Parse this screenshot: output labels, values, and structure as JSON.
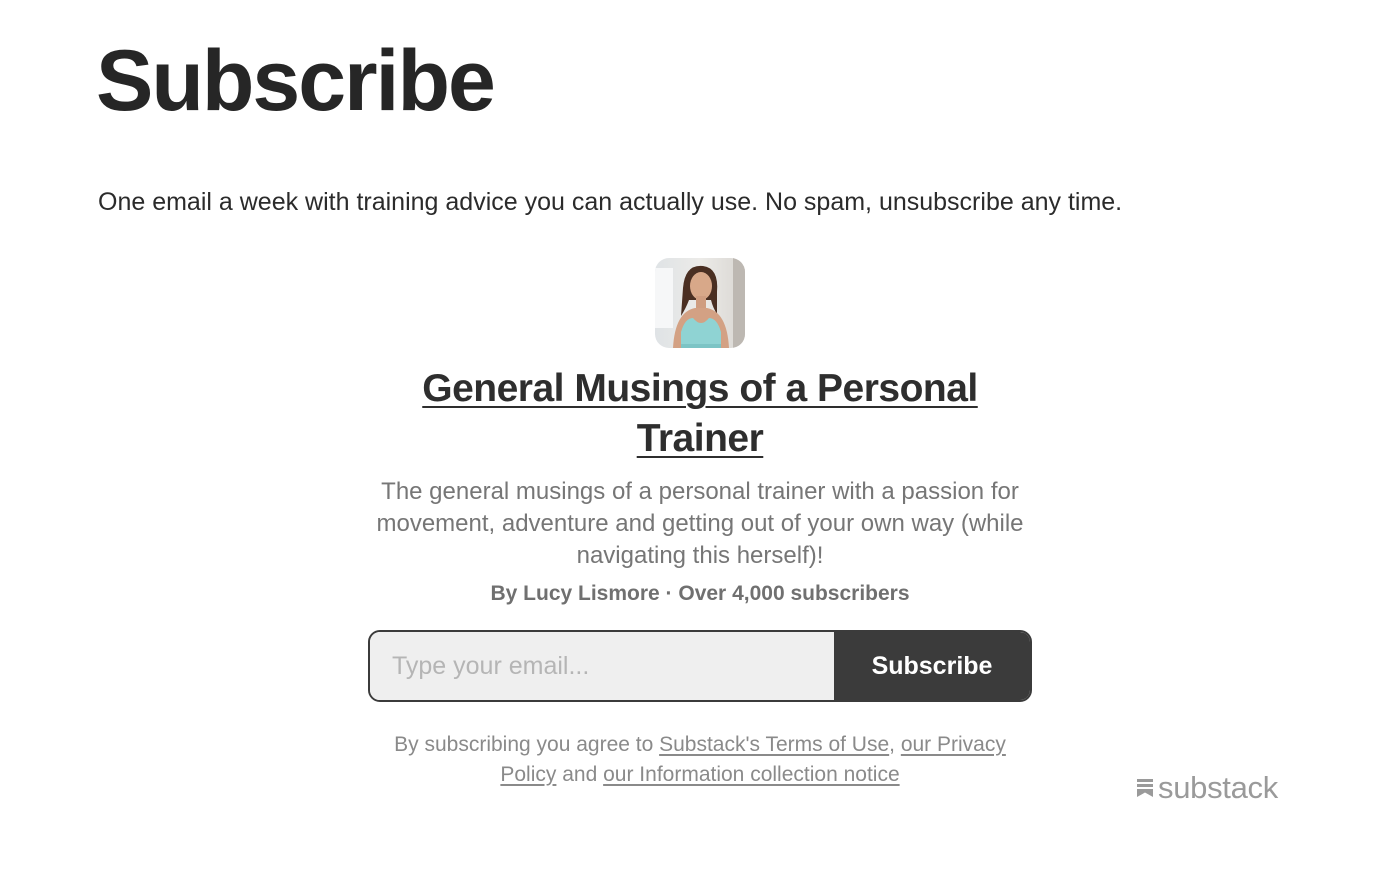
{
  "page": {
    "title": "Subscribe",
    "intro": "One email a week with training advice you can actually use. No spam, unsubscribe any time."
  },
  "publication": {
    "avatar_icon": "author-photo-avatar",
    "title": "General Musings of a Personal Trainer",
    "description": "The general musings of a personal trainer with a passion for movement, adventure and getting out of your own way (while navigating this herself)!",
    "meta": "By Lucy Lismore · Over 4,000 subscribers"
  },
  "form": {
    "email_placeholder": "Type your email...",
    "button_label": "Subscribe"
  },
  "legal": {
    "prefix": "By subscribing you agree to ",
    "terms_link": "Substack's Terms of Use",
    "comma": ", ",
    "privacy_link": "our Privacy Policy",
    "and": " and ",
    "notice_link": "our Information collection notice"
  },
  "branding": {
    "logo_text": "substack",
    "logo_icon": "substack-bookmark-icon"
  },
  "colors": {
    "button": "#3b3b3b",
    "input_bg": "#efefef",
    "muted_text": "#8a8a8a"
  }
}
